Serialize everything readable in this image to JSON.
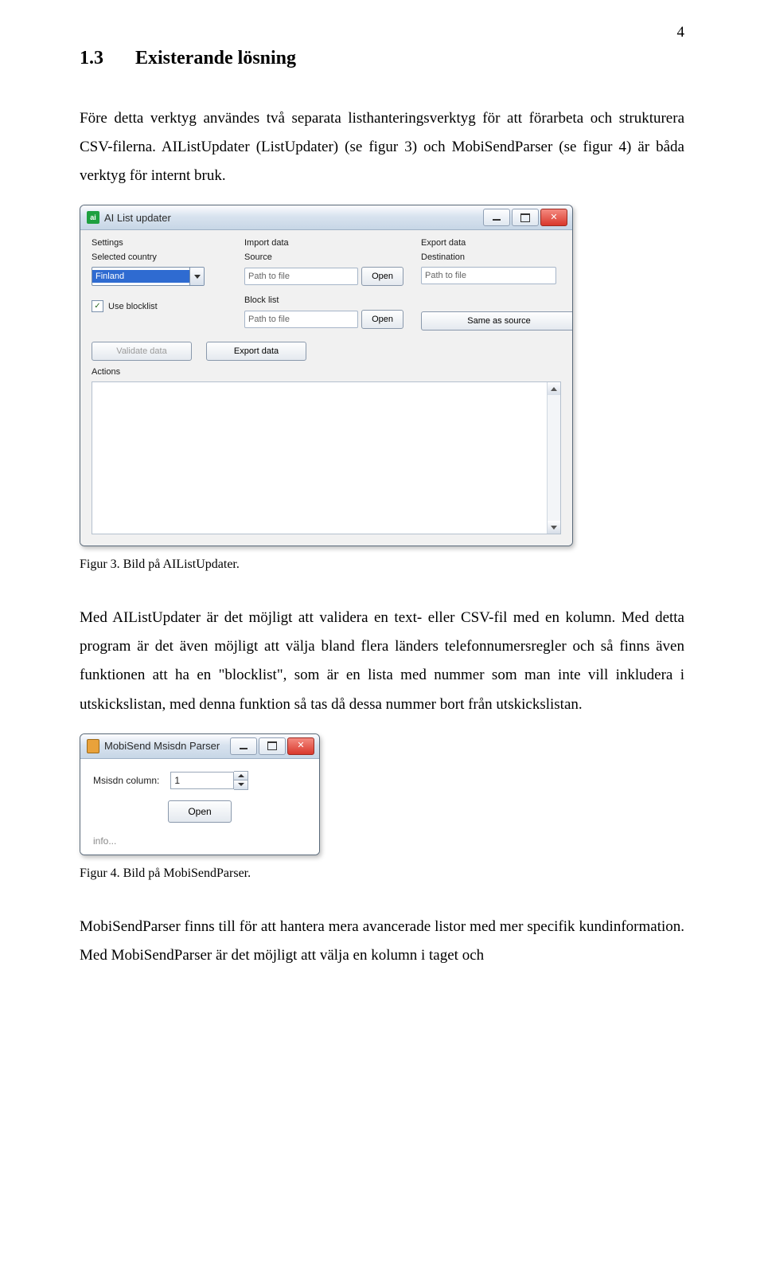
{
  "page_number": "4",
  "heading": {
    "number": "1.3",
    "title": "Existerande lösning"
  },
  "para1": "Före detta verktyg användes två separata listhanteringsverktyg för att förarbeta och strukturera CSV-filerna. AIListUpdater (ListUpdater) (se figur 3) och MobiSendParser (se figur 4) är båda verktyg för internt bruk.",
  "figure3_caption": "Figur 3. Bild på AIListUpdater.",
  "para2": "Med AIListUpdater är det möjligt att validera en text- eller CSV-fil med en kolumn. Med detta program är det även möjligt att välja bland flera länders telefonnumersregler och så finns även funktionen att ha en \"blocklist\", som är en lista med nummer som man inte vill inkludera i utskickslistan, med denna funktion så tas då dessa nummer bort från utskickslistan.",
  "figure4_caption": "Figur 4. Bild på MobiSendParser.",
  "para3": "MobiSendParser finns till för att hantera mera avancerade listor med mer specifik kundinformation. Med MobiSendParser är det möjligt att välja en kolumn i taget och",
  "ailu": {
    "title": "AI List updater",
    "settings_label": "Settings",
    "selected_country_label": "Selected country",
    "country_value": "Finland",
    "use_blocklist_label": "Use blocklist",
    "import_data_label": "Import data",
    "source_label": "Source",
    "path_placeholder": "Path to file",
    "open_label": "Open",
    "block_list_label": "Block list",
    "export_data_label": "Export data",
    "destination_label": "Destination",
    "same_as_source_label": "Same as source",
    "validate_label": "Validate data",
    "export_btn_label": "Export data",
    "actions_label": "Actions"
  },
  "msp": {
    "title": "MobiSend Msisdn Parser",
    "column_label": "Msisdn column:",
    "column_value": "1",
    "open_label": "Open",
    "info_label": "info..."
  }
}
